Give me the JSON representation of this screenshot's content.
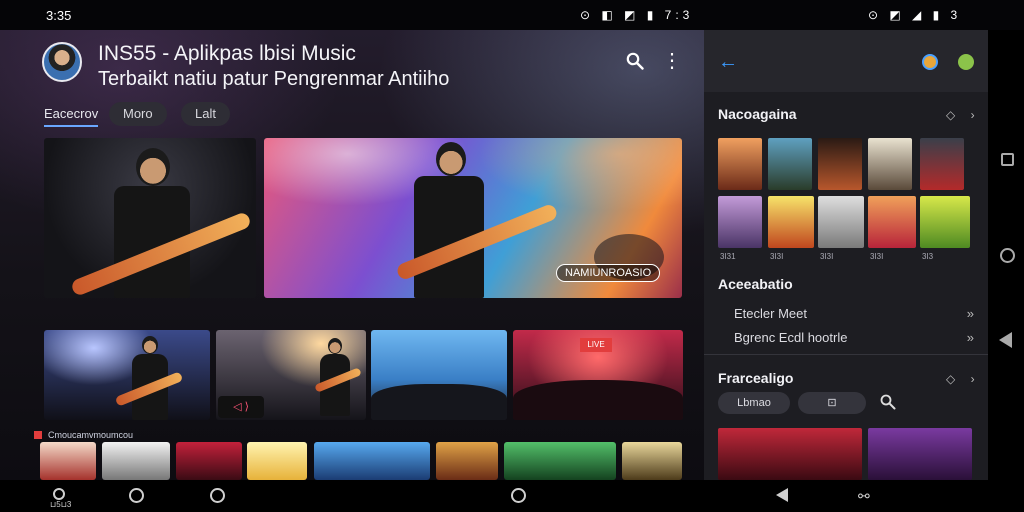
{
  "status": {
    "time": "3:35",
    "left_icons": "⊙ ◧ ◩ ▮ 7:3",
    "right_icons": "⊙ ◩ ◢ ▮ 3"
  },
  "header": {
    "title_line1": "INS55 - Aplikpas lbisi Music",
    "title_line2": "Terbaikt natiu patur Pengrenmar Antiiho",
    "search_icon": "search-icon",
    "more_icon": "more-vertical-icon"
  },
  "tabs": {
    "active": "Eacecrov",
    "pills": [
      "Moro",
      "Lalt"
    ]
  },
  "hero": {
    "caption": "NAMIUNROASIO"
  },
  "thumbs": {
    "t2_badge": "◁ ⟩",
    "t4_badge": "LIVE"
  },
  "row": {
    "label": "Cmoucamvmoumcou"
  },
  "side": {
    "back_icon": "arrow-left-icon",
    "section1": {
      "title": "Nacoagaina",
      "controls": "◇ ›"
    },
    "grid_captions": [
      "3I31",
      "3I3I",
      "3I3I",
      "3I3I",
      "3I3"
    ],
    "section2": {
      "title": "Aceeabatio"
    },
    "list": [
      {
        "label": "Etecler Meet",
        "chev": "»"
      },
      {
        "label": "Bgrenc Ecdl hootrle",
        "chev": "»"
      }
    ],
    "section3": {
      "title": "Frarcealigo",
      "controls": "◇ ›"
    },
    "buttons": [
      "Lbmao",
      "⊡"
    ],
    "search_icon": "search-icon"
  },
  "nav": {
    "label": "⊔5⊔3"
  },
  "colors": {
    "accent": "#6aa7ff",
    "back_arrow": "#3b9bff",
    "panel": "#1d1d22"
  }
}
